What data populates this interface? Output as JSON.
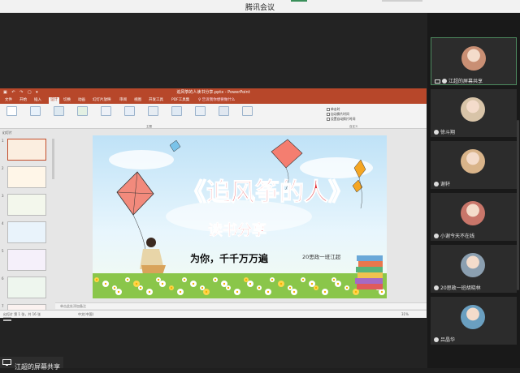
{
  "app": {
    "title": "腾讯会议"
  },
  "ppt": {
    "window_title": "追风筝的人读书分享.pptx - PowerPoint",
    "tabs": [
      "文件",
      "开始",
      "插入",
      "设计",
      "切换",
      "动画",
      "幻灯片放映",
      "审阅",
      "视图",
      "开发工具",
      "PDF工具集"
    ],
    "active_tab": "设计",
    "search": "告诉我你想要做什么",
    "ribbon_buttons": [
      "主题",
      "",
      "",
      "",
      "",
      "",
      "",
      "",
      "",
      "",
      "",
      "幻灯片大小",
      "设置背景格式"
    ],
    "group_theme": "主题",
    "group_variant": "变体",
    "group_custom": "自定义",
    "options": [
      "单击时",
      "自动换片时间",
      "设置自动换片时间"
    ],
    "side_label": "幻灯片",
    "notes_placeholder": "单击此处添加备注",
    "status_left": "幻灯片 第 1 张，共 16 张",
    "status_lang": "中文(中国)",
    "status_zoom": "31%"
  },
  "slide": {
    "title": "《追风筝的人》",
    "subtitle": "读书分享",
    "tagline": "为你，千千万万遍",
    "author": "20思政一班江超"
  },
  "share_label": "江超的屏幕共享",
  "participants": [
    {
      "name": "江超的屏幕共享",
      "avatar_color": "#c98f74",
      "selected": true,
      "screen": true
    },
    {
      "name": "徐斗翔",
      "avatar_color": "#d8c4a8",
      "selected": false,
      "screen": false
    },
    {
      "name": "谢轩",
      "avatar_color": "#d9b48a",
      "selected": false,
      "screen": false
    },
    {
      "name": "小谢今天不在线",
      "avatar_color": "#c9766a",
      "selected": false,
      "screen": false
    },
    {
      "name": "20思政一班胡晓林",
      "avatar_color": "#8b9fb0",
      "selected": false,
      "screen": false
    },
    {
      "name": "吕晶华",
      "avatar_color": "#6a9fc0",
      "selected": false,
      "screen": false
    }
  ]
}
